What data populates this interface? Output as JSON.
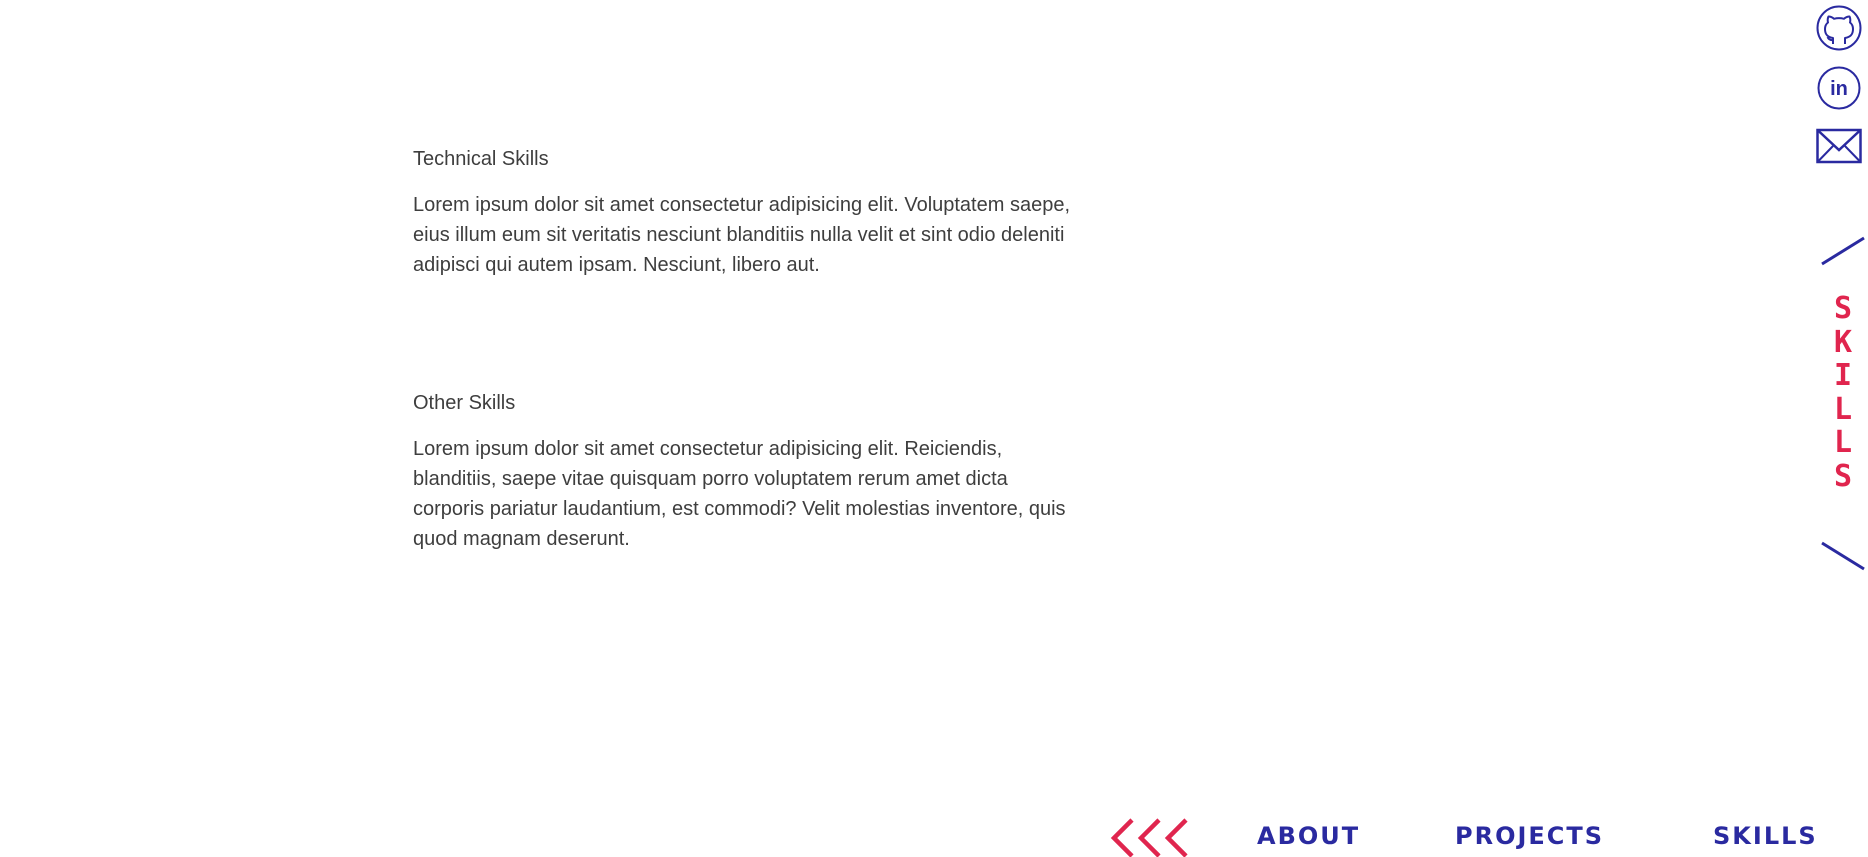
{
  "sections": [
    {
      "title": "Technical Skills",
      "body": "Lorem ipsum dolor sit amet consectetur adipisicing elit. Voluptatem saepe, eius illum eum sit veritatis nesciunt blanditiis nulla velit et sint odio deleniti adipisci qui autem ipsam. Nesciunt, libero aut."
    },
    {
      "title": "Other Skills",
      "body": "Lorem ipsum dolor sit amet consectetur adipisicing elit. Reiciendis, blanditiis, saepe vitae quisquam porro voluptatem rerum amet dicta corporis pariatur laudantium, est commodi? Velit molestias inventore, quis quod magnam deserunt."
    }
  ],
  "social": [
    {
      "icon": "github-icon"
    },
    {
      "icon": "linkedin-icon",
      "label": "in"
    },
    {
      "icon": "mail-icon"
    }
  ],
  "side_title": {
    "letters": [
      "S",
      "K",
      "I",
      "L",
      "L",
      "S"
    ]
  },
  "nav": {
    "back_icon": "triple-chevron-left-icon",
    "links": [
      "About",
      "Projects",
      "Skills"
    ]
  },
  "colors": {
    "accent": "#e0254e",
    "brand": "#2a2aa0",
    "text": "#3e3e3e",
    "background": "#ffffff"
  }
}
